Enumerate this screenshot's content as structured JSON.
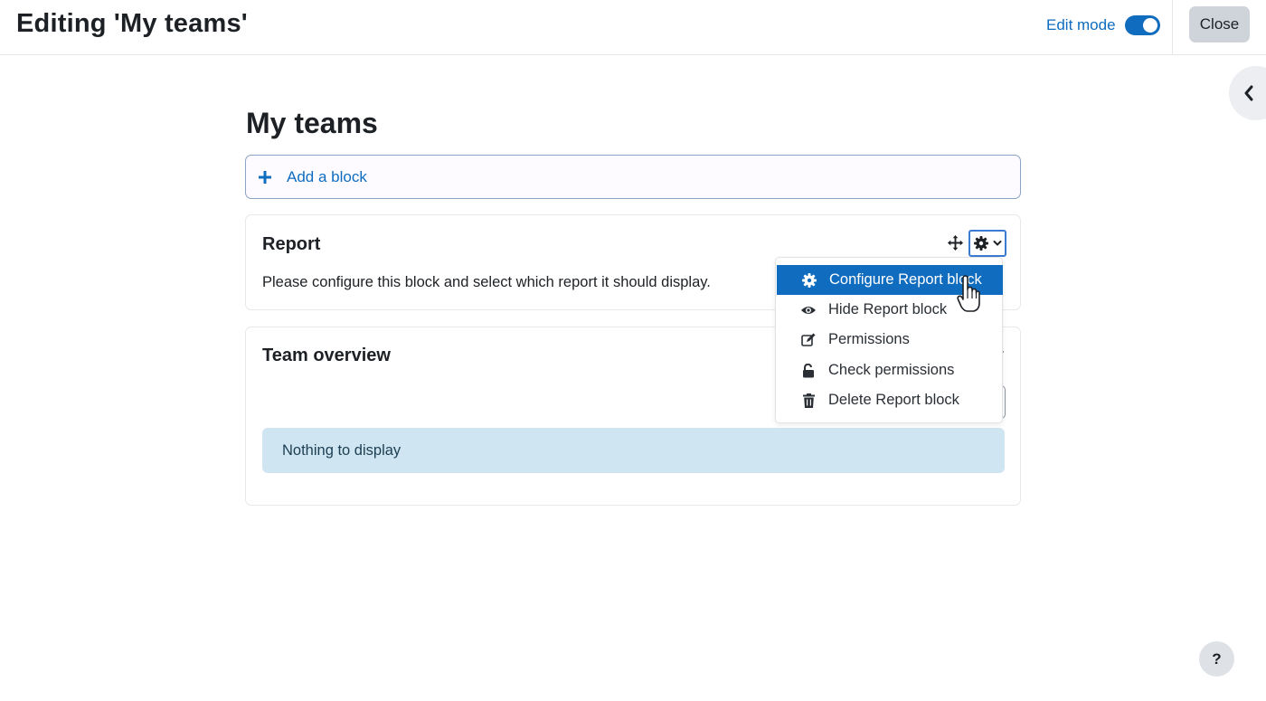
{
  "header": {
    "title": "Editing 'My teams'",
    "edit_mode_label": "Edit mode",
    "edit_mode_on": true,
    "close_label": "Close"
  },
  "main": {
    "title": "My teams",
    "add_block_label": "Add a block"
  },
  "blocks": {
    "report": {
      "title": "Report",
      "message": "Please configure this block and select which report it should display."
    },
    "team_overview": {
      "title": "Team overview",
      "empty_message": "Nothing to display"
    }
  },
  "block_menu": {
    "items": [
      {
        "label": "Configure Report block",
        "icon": "gear-icon",
        "active": true
      },
      {
        "label": "Hide Report block",
        "icon": "eye-icon",
        "active": false
      },
      {
        "label": "Permissions",
        "icon": "edit-icon",
        "active": false
      },
      {
        "label": "Check permissions",
        "icon": "unlock-icon",
        "active": false
      },
      {
        "label": "Delete Report block",
        "icon": "trash-icon",
        "active": false
      }
    ]
  },
  "help_label": "?",
  "colors": {
    "primary": "#0f6cbf",
    "info_bg": "#cfe5f2",
    "button_secondary": "#ced4da"
  }
}
